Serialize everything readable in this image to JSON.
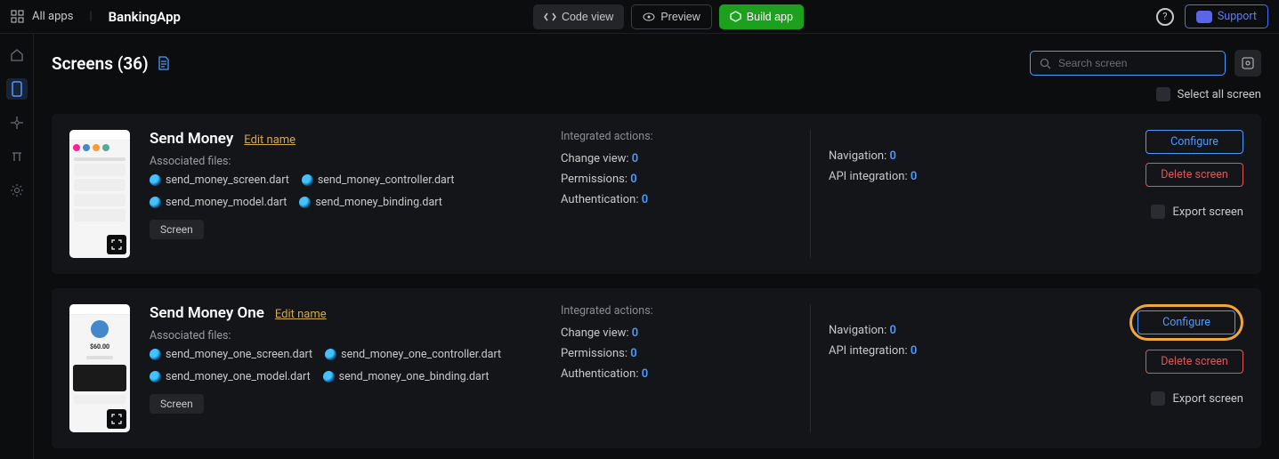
{
  "topbar": {
    "all_apps": "All apps",
    "app_name": "BankingApp",
    "code_view": "Code view",
    "preview": "Preview",
    "build_app": "Build app",
    "support": "Support"
  },
  "page": {
    "title": "Screens (36)",
    "search_placeholder": "Search screen",
    "select_all": "Select all screen"
  },
  "cards": [
    {
      "name": "Send Money",
      "edit": "Edit name",
      "assoc_label": "Associated files:",
      "files": [
        "send_money_screen.dart",
        "send_money_controller.dart",
        "send_money_model.dart",
        "send_money_binding.dart"
      ],
      "tag": "Screen",
      "integrated_label": "Integrated actions:",
      "stats": {
        "change_view_label": "Change view:",
        "change_view": "0",
        "permissions_label": "Permissions:",
        "permissions": "0",
        "auth_label": "Authentication:",
        "auth": "0",
        "nav_label": "Navigation:",
        "nav": "0",
        "api_label": "API integration:",
        "api": "0"
      },
      "configure": "Configure",
      "delete": "Delete screen",
      "export": "Export screen"
    },
    {
      "name": "Send Money One",
      "edit": "Edit name",
      "assoc_label": "Associated files:",
      "files": [
        "send_money_one_screen.dart",
        "send_money_one_controller.dart",
        "send_money_one_model.dart",
        "send_money_one_binding.dart"
      ],
      "tag": "Screen",
      "integrated_label": "Integrated actions:",
      "stats": {
        "change_view_label": "Change view:",
        "change_view": "0",
        "permissions_label": "Permissions:",
        "permissions": "0",
        "auth_label": "Authentication:",
        "auth": "0",
        "nav_label": "Navigation:",
        "nav": "0",
        "api_label": "API integration:",
        "api": "0"
      },
      "configure": "Configure",
      "delete": "Delete screen",
      "export": "Export screen"
    }
  ]
}
